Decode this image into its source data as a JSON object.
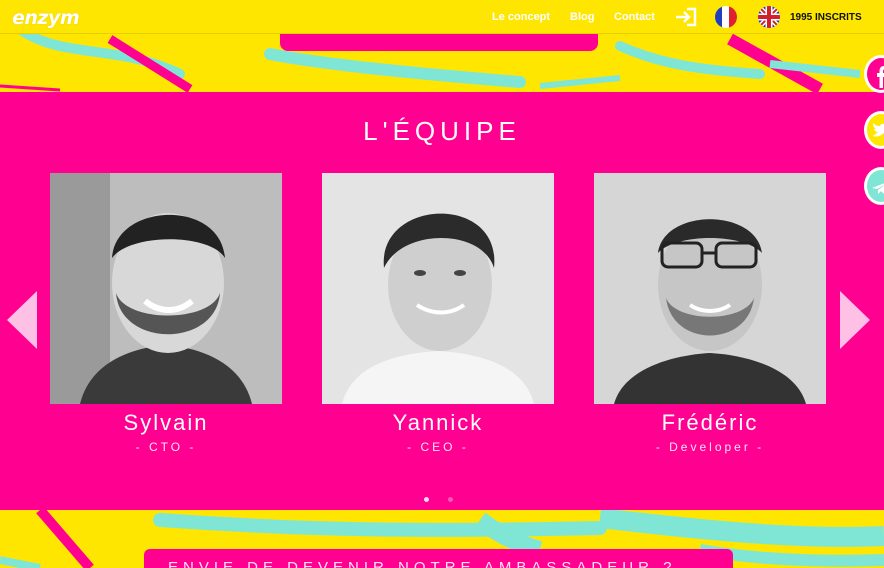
{
  "header": {
    "logo": "enzym",
    "nav": [
      "Le concept",
      "Blog",
      "Contact"
    ],
    "inscrits": "1995 INSCRITS"
  },
  "team": {
    "title": "L'ÉQUIPE",
    "members": [
      {
        "name": "Sylvain",
        "role": "- CTO -"
      },
      {
        "name": "Yannick",
        "role": "- CEO -"
      },
      {
        "name": "Frédéric",
        "role": "- Developer -"
      }
    ],
    "active_dot": 1,
    "dots_total": 2
  },
  "cta": {
    "label": "ENVIE DE DEVENIR NOTRE AMBASSADEUR ?"
  },
  "icons": {
    "login": "login-icon",
    "flag_fr": "france-flag-icon",
    "flag_uk": "uk-flag-icon",
    "prev": "chevron-left-icon",
    "next": "chevron-right-icon",
    "social": [
      "facebook-icon",
      "twitter-icon",
      "telegram-icon"
    ]
  },
  "colors": {
    "pink": "#ff0090",
    "yellow": "#ffe600",
    "mint": "#7fe6d6",
    "arrow": "#ffc0e6"
  }
}
